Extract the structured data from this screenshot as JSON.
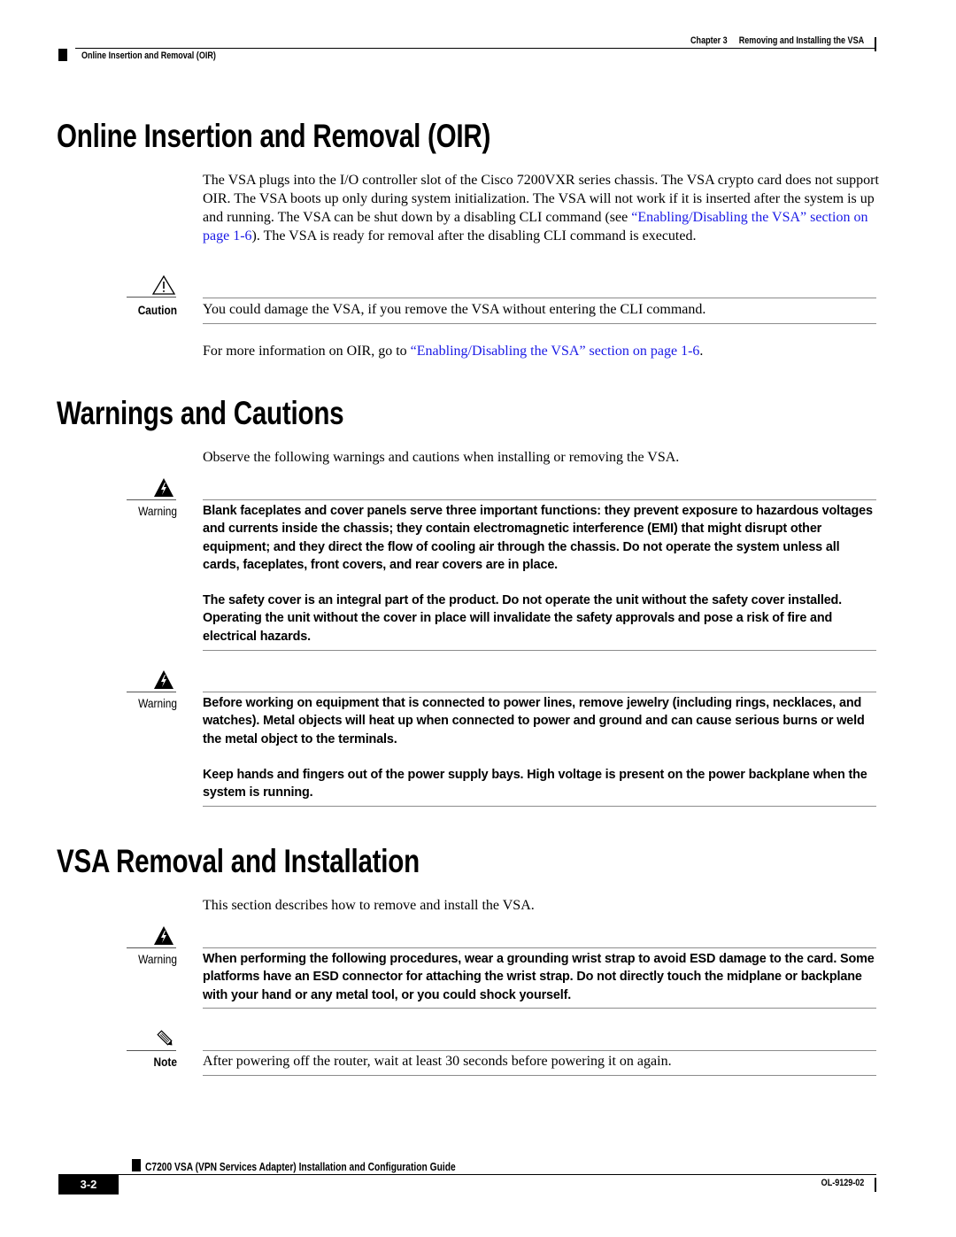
{
  "header": {
    "chapter": "Chapter 3",
    "chapter_title": "Removing and Installing the VSA",
    "section": "Online Insertion and Removal (OIR)"
  },
  "sections": {
    "oir": {
      "title": "Online Insertion and Removal (OIR)",
      "para_before_link": "The VSA plugs into the I/O controller slot of the Cisco 7200VXR series chassis. The VSA crypto card does not support OIR. The VSA boots up only during system initialization. The VSA will not work if it is inserted after the system is up and running. The VSA can be shut down by a disabling CLI command (see ",
      "para_link": "“Enabling/Disabling the VSA” section on page 1-6",
      "para_after_link": "). The VSA is ready for removal after the disabling CLI command is executed.",
      "caution_label": "Caution",
      "caution_text": "You could damage the VSA, if you remove the VSA without entering the CLI command.",
      "more_info_before": "For more information on OIR, go to ",
      "more_info_link": "“Enabling/Disabling the VSA” section on page 1-6",
      "more_info_after": "."
    },
    "warnings": {
      "title": "Warnings and Cautions",
      "intro": "Observe the following warnings and cautions when installing or removing the VSA.",
      "warning1_label": "Warning",
      "warning1_p1": "Blank faceplates and cover panels serve three important functions: they prevent exposure to hazardous voltages and currents inside the chassis; they contain electromagnetic interference (EMI) that might disrupt other equipment; and they direct the flow of cooling air through the chassis. Do not operate the system unless all cards, faceplates, front covers, and rear covers are in place.",
      "warning1_p2": "The safety cover is an integral part of the product. Do not operate the unit without the safety cover installed. Operating the unit without the cover in place will invalidate the safety approvals and pose a risk of fire and electrical hazards.",
      "warning2_label": "Warning",
      "warning2_p1": "Before working on equipment that is connected to power lines, remove jewelry (including rings, necklaces, and watches). Metal objects will heat up when connected to power and ground and can cause serious burns or weld the metal object to the terminals.",
      "warning2_p2": "Keep hands and fingers out of the power supply bays. High voltage is present on the power backplane when the system is running."
    },
    "removal": {
      "title": "VSA Removal and Installation",
      "intro": "This section describes how to remove and install the VSA.",
      "warning_label": "Warning",
      "warning_text": "When performing the following procedures, wear a grounding wrist strap to avoid ESD damage to the card. Some platforms have an ESD connector for attaching the wrist strap. Do not directly touch the midplane or backplane with your hand or any metal tool, or you could shock yourself.",
      "note_label": "Note",
      "note_text": "After powering off the router, wait at least 30 seconds before powering it on again."
    }
  },
  "footer": {
    "guide_title": "C7200 VSA (VPN Services Adapter) Installation and Configuration Guide",
    "page_number": "3-2",
    "doc_number": "OL-9129-02"
  },
  "colors": {
    "link": "#1a1ae6",
    "rule": "#8c8c8c"
  }
}
